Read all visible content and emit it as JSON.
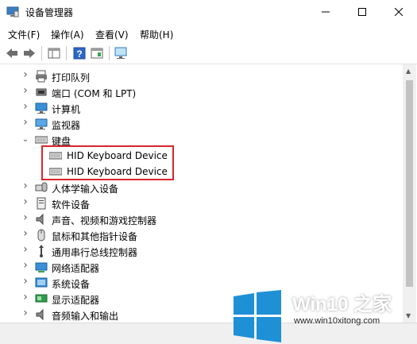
{
  "window": {
    "title": "设备管理器"
  },
  "menubar": {
    "items": [
      "文件(F)",
      "操作(A)",
      "查看(V)",
      "帮助(H)"
    ]
  },
  "tree": {
    "rows": [
      {
        "label": "打印队列",
        "icon": "printer-icon",
        "expanded": false
      },
      {
        "label": "端口 (COM 和 LPT)",
        "icon": "port-icon",
        "expanded": false
      },
      {
        "label": "计算机",
        "icon": "computer-icon",
        "expanded": false
      },
      {
        "label": "监视器",
        "icon": "monitor-icon",
        "expanded": false
      },
      {
        "label": "键盘",
        "icon": "keyboard-icon",
        "expanded": true
      },
      {
        "label": "HID Keyboard Device",
        "icon": "keyboard-icon",
        "child": true
      },
      {
        "label": "HID Keyboard Device",
        "icon": "keyboard-icon",
        "child": true
      },
      {
        "label": "人体学输入设备",
        "icon": "hid-icon",
        "expanded": false
      },
      {
        "label": "软件设备",
        "icon": "software-device-icon",
        "expanded": false
      },
      {
        "label": "声音、视频和游戏控制器",
        "icon": "speaker-icon",
        "expanded": false
      },
      {
        "label": "鼠标和其他指针设备",
        "icon": "mouse-icon",
        "expanded": false
      },
      {
        "label": "通用串行总线控制器",
        "icon": "usb-icon",
        "expanded": false
      },
      {
        "label": "网络适配器",
        "icon": "network-adapter-icon",
        "expanded": false
      },
      {
        "label": "系统设备",
        "icon": "system-device-icon",
        "expanded": false
      },
      {
        "label": "显示适配器",
        "icon": "display-adapter-icon",
        "expanded": false
      },
      {
        "label": "音频输入和输出",
        "icon": "audio-icon",
        "expanded": false
      }
    ]
  },
  "highlight_color": "#d9252d",
  "watermark": {
    "brand": "Win10 之家",
    "url": "www.win10xitong.com",
    "logo_color": "#1e90d6"
  }
}
